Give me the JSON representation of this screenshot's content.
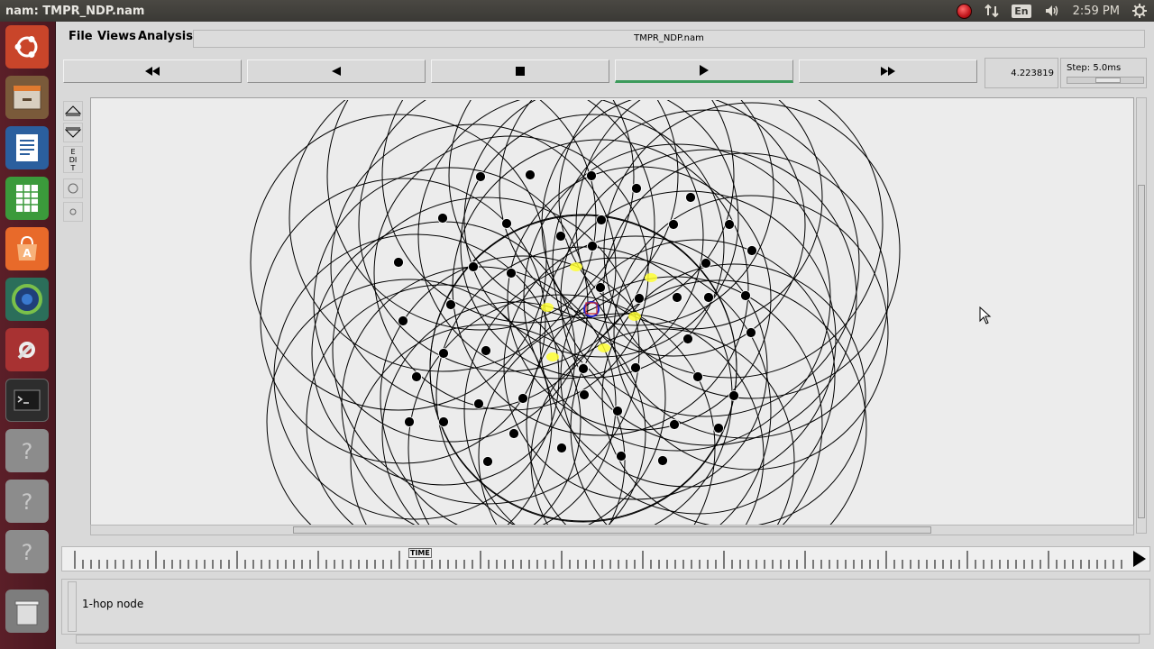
{
  "top_panel": {
    "window_title": "nam: TMPR_NDP.nam",
    "keyboard_layout": "En",
    "clock": "2:59 PM"
  },
  "launcher": {
    "items": [
      "ubuntu-logo-icon",
      "files-icon",
      "writer-icon",
      "calc-icon",
      "software-center-icon",
      "browser-icon",
      "system-settings-icon",
      "terminal-icon",
      "unknown-app-icon",
      "unknown-app-icon",
      "unknown-app-icon",
      "trash-icon"
    ]
  },
  "menu": {
    "file": "File",
    "views": "Views",
    "analysis": "Analysis",
    "file_title": "TMPR_NDP.nam"
  },
  "transport": {
    "current_time": "4.223819",
    "step": "Step: 5.0ms",
    "step_slider_fraction": 0.55
  },
  "side_tools": {
    "edit": "EDIT"
  },
  "timeline": {
    "marker": "TIME"
  },
  "annotation": {
    "text": "1-hop node"
  },
  "colors": {
    "canvas": "#ececec",
    "node": "#000000",
    "range_circle": "#000000",
    "packet": "#ffff33",
    "highlight_blue": "#2222cc",
    "highlight_red": "#cc2222",
    "play_active": "#3c9a5b"
  }
}
